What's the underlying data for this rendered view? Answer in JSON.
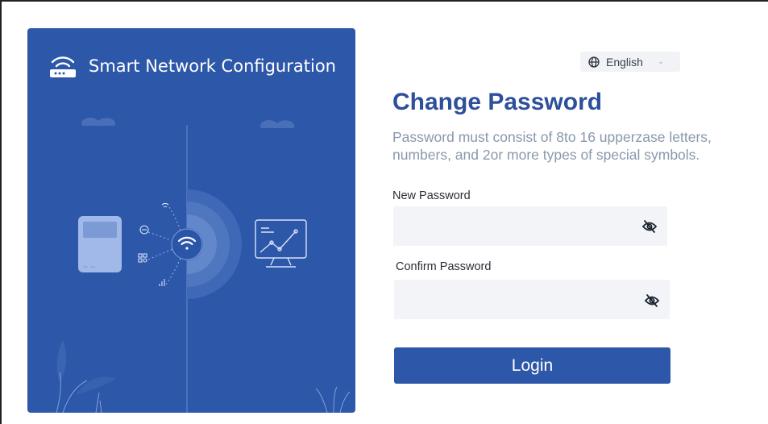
{
  "hero": {
    "title": "Smart Network Configuration"
  },
  "language": {
    "selected": "English"
  },
  "form": {
    "title": "Change Password",
    "hint": "Password must consist of 8to 16 upperzase letters, numbers, and 2or more types of special symbols.",
    "new_password": {
      "label": "New Password",
      "value": "",
      "placeholder": ""
    },
    "confirm_password": {
      "label": "Confirm Password",
      "value": "",
      "placeholder": ""
    },
    "submit_label": "Login"
  },
  "colors": {
    "brand": "#2d57a8",
    "title": "#2e4f9a",
    "hint": "#8a98ad",
    "field_bg": "#f2f4f8"
  },
  "icons": {
    "hero": "router-icon",
    "language": "globe-icon",
    "dropdown": "chevron-down-icon",
    "password_visibility": "eye-off-icon"
  }
}
